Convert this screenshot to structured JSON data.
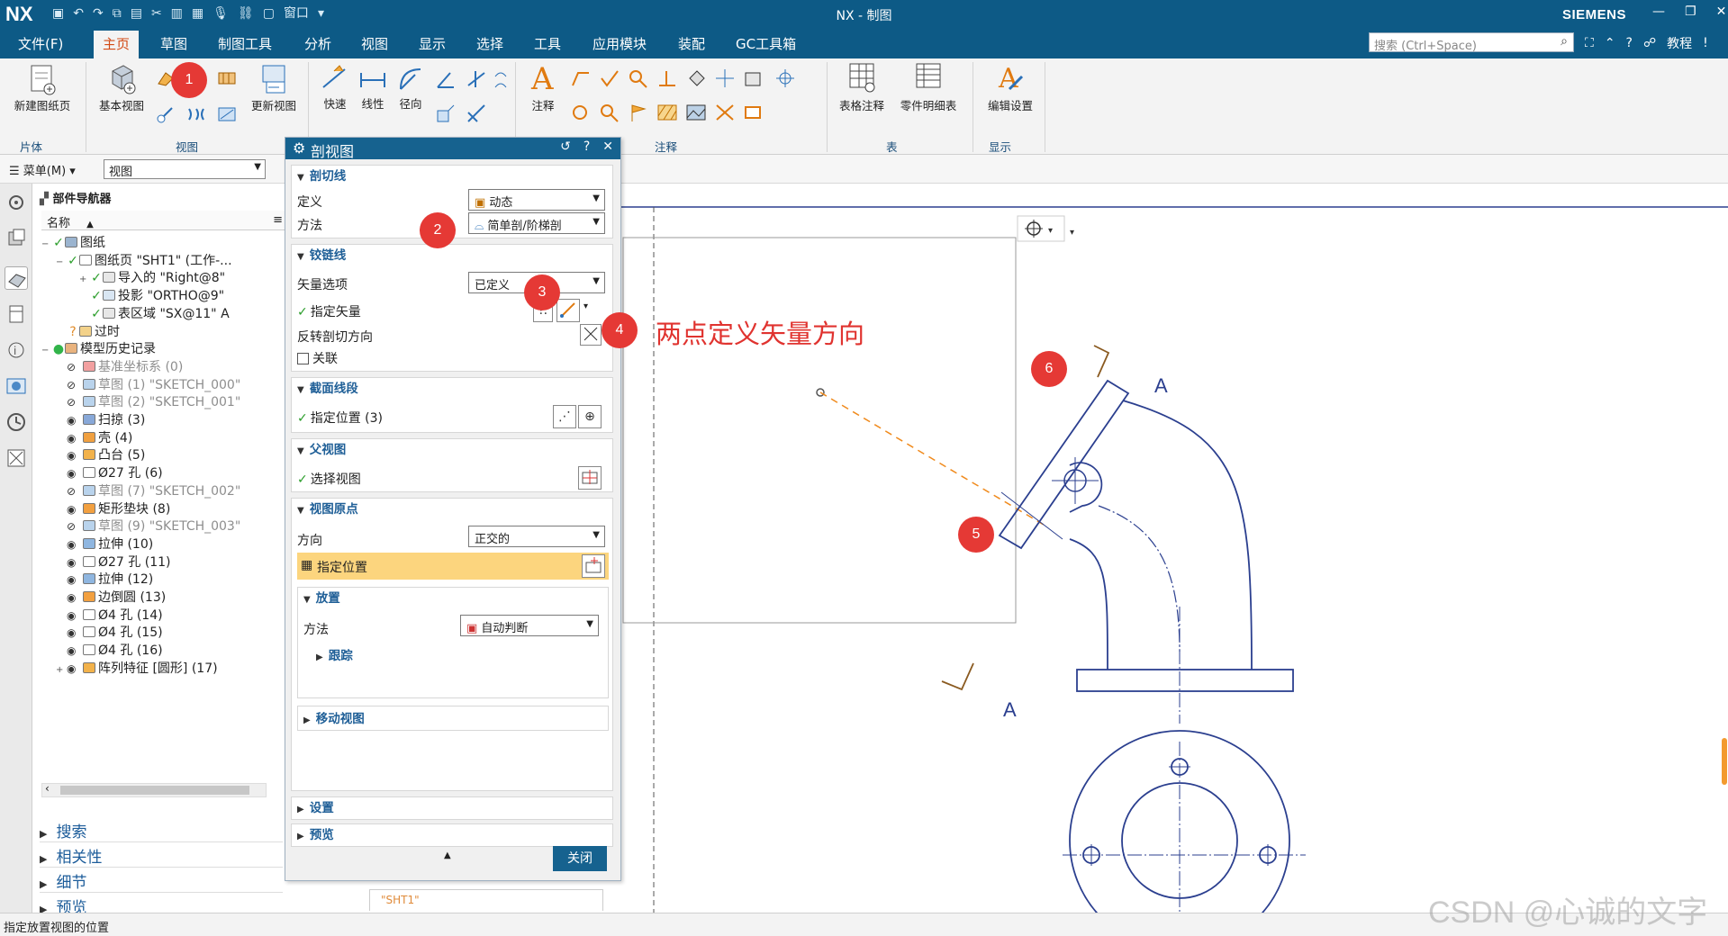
{
  "titlebar": {
    "logo": "NX",
    "title": "NX - 制图",
    "brand": "SIEMENS",
    "window_label": "窗口"
  },
  "menu": {
    "tabs": [
      "文件(F)",
      "主页",
      "草图",
      "制图工具",
      "分析",
      "视图",
      "显示",
      "选择",
      "工具",
      "应用模块",
      "装配",
      "GC工具箱"
    ],
    "active_tab": "主页",
    "search_placeholder": "搜索 (Ctrl+Space)",
    "tutorial": "教程"
  },
  "ribbon": {
    "new_sheet": "新建图纸页",
    "base_view": "基本视图",
    "update_view": "更新视图",
    "quick": "快速",
    "linear": "线性",
    "radial": "径向",
    "note": "注释",
    "table_note": "表格注释",
    "parts_list": "零件明细表",
    "edit_settings": "编辑设置",
    "groups": {
      "sheet": "片体",
      "view": "视图",
      "annotation": "注释",
      "table": "表",
      "display": "显示"
    }
  },
  "toolbar2": {
    "menu_btn": "菜单(M)",
    "view_select": "视图"
  },
  "navigator": {
    "title": "部件导航器",
    "col_name": "名称",
    "rows": [
      {
        "label": "图纸",
        "indent": 0,
        "dim": false,
        "icon": "sheet-icon"
      },
      {
        "label": "图纸页 \"SHT1\" (工作-...",
        "indent": 1,
        "dim": false,
        "icon": "sheet-page-icon"
      },
      {
        "label": "导入的 \"Right@8\"",
        "indent": 2,
        "dim": false,
        "icon": "imported-view-icon"
      },
      {
        "label": "投影 \"ORTHO@9\"",
        "indent": 2,
        "dim": false,
        "icon": "projected-view-icon"
      },
      {
        "label": "表区域 \"SX@11\" A",
        "indent": 2,
        "dim": false,
        "icon": "section-view-icon"
      },
      {
        "label": "过时",
        "indent": 1,
        "dim": false,
        "icon": "outdated-icon"
      },
      {
        "label": "模型历史记录",
        "indent": 0,
        "dim": false,
        "icon": "model-history-icon"
      },
      {
        "label": "基准坐标系 (0)",
        "indent": 1,
        "dim": true,
        "icon": "datum-csys-icon"
      },
      {
        "label": "草图 (1) \"SKETCH_000\"",
        "indent": 1,
        "dim": true,
        "icon": "sketch-icon"
      },
      {
        "label": "草图 (2) \"SKETCH_001\"",
        "indent": 1,
        "dim": true,
        "icon": "sketch-icon"
      },
      {
        "label": "扫掠 (3)",
        "indent": 1,
        "dim": false,
        "icon": "sweep-icon"
      },
      {
        "label": "壳 (4)",
        "indent": 1,
        "dim": false,
        "icon": "shell-icon"
      },
      {
        "label": "凸台 (5)",
        "indent": 1,
        "dim": false,
        "icon": "boss-icon"
      },
      {
        "label": "Ø27 孔 (6)",
        "indent": 1,
        "dim": false,
        "icon": "hole-icon"
      },
      {
        "label": "草图 (7) \"SKETCH_002\"",
        "indent": 1,
        "dim": true,
        "icon": "sketch-icon"
      },
      {
        "label": "矩形垫块 (8)",
        "indent": 1,
        "dim": false,
        "icon": "pad-icon"
      },
      {
        "label": "草图 (9) \"SKETCH_003\"",
        "indent": 1,
        "dim": true,
        "icon": "sketch-icon"
      },
      {
        "label": "拉伸 (10)",
        "indent": 1,
        "dim": false,
        "icon": "extrude-icon"
      },
      {
        "label": "Ø27 孔 (11)",
        "indent": 1,
        "dim": false,
        "icon": "hole-icon"
      },
      {
        "label": "拉伸 (12)",
        "indent": 1,
        "dim": false,
        "icon": "extrude-icon"
      },
      {
        "label": "边倒圆 (13)",
        "indent": 1,
        "dim": false,
        "icon": "edge-blend-icon"
      },
      {
        "label": "Ø4 孔 (14)",
        "indent": 1,
        "dim": false,
        "icon": "hole-icon"
      },
      {
        "label": "Ø4 孔 (15)",
        "indent": 1,
        "dim": false,
        "icon": "hole-icon"
      },
      {
        "label": "Ø4 孔 (16)",
        "indent": 1,
        "dim": false,
        "icon": "hole-icon"
      },
      {
        "label": "阵列特征 [圆形] (17)",
        "indent": 1,
        "dim": false,
        "icon": "pattern-icon"
      }
    ]
  },
  "accordion": [
    "搜索",
    "相关性",
    "细节",
    "预览"
  ],
  "dialog": {
    "title": "剖视图",
    "sec_cutline": "剖切线",
    "define_label": "定义",
    "define_value": "动态",
    "method_label": "方法",
    "method_value": "简单剖/阶梯剖",
    "sec_hinge": "铰链线",
    "vector_opt_label": "矢量选项",
    "vector_opt_value": "已定义",
    "specify_vector": "指定矢量",
    "reverse_dir": "反转剖切方向",
    "assoc": "关联",
    "sec_segment": "截面线段",
    "specify_location": "指定位置 (3)",
    "sec_parent": "父视图",
    "select_view": "选择视图",
    "sec_origin": "视图原点",
    "direction_label": "方向",
    "direction_value": "正交的",
    "specify_pos": "指定位置",
    "sec_place": "放置",
    "place_method_label": "方法",
    "place_method_value": "自动判断",
    "track": "跟踪",
    "move_view": "移动视图",
    "settings": "设置",
    "preview": "预览",
    "close": "关闭"
  },
  "annotation": "两点定义矢量方向",
  "callouts": [
    "1",
    "2",
    "3",
    "4",
    "5",
    "6"
  ],
  "drawing": {
    "section_label": "A"
  },
  "sheet_tab": "\"SHT1\"",
  "status": "指定放置视图的位置",
  "watermark": "CSDN @心诚的文字",
  "colors": {
    "title_bg": "#0d5a86",
    "active_tab": "#d34b17",
    "callout": "#e53935",
    "annotation": "#e0332f",
    "drawing_line": "#2b3f8f",
    "highlight": "#fcd57e"
  }
}
